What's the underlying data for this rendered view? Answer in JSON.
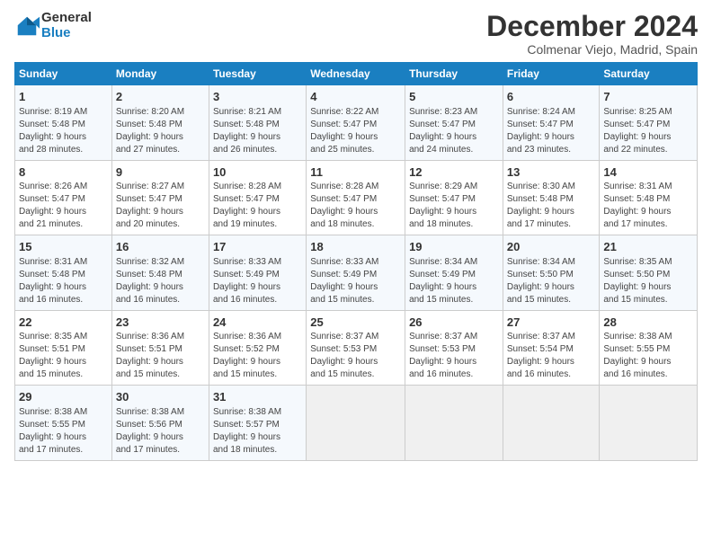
{
  "logo": {
    "text_general": "General",
    "text_blue": "Blue"
  },
  "header": {
    "month": "December 2024",
    "location": "Colmenar Viejo, Madrid, Spain"
  },
  "days_of_week": [
    "Sunday",
    "Monday",
    "Tuesday",
    "Wednesday",
    "Thursday",
    "Friday",
    "Saturday"
  ],
  "weeks": [
    [
      {
        "day": "1",
        "info": "Sunrise: 8:19 AM\nSunset: 5:48 PM\nDaylight: 9 hours\nand 28 minutes."
      },
      {
        "day": "2",
        "info": "Sunrise: 8:20 AM\nSunset: 5:48 PM\nDaylight: 9 hours\nand 27 minutes."
      },
      {
        "day": "3",
        "info": "Sunrise: 8:21 AM\nSunset: 5:48 PM\nDaylight: 9 hours\nand 26 minutes."
      },
      {
        "day": "4",
        "info": "Sunrise: 8:22 AM\nSunset: 5:47 PM\nDaylight: 9 hours\nand 25 minutes."
      },
      {
        "day": "5",
        "info": "Sunrise: 8:23 AM\nSunset: 5:47 PM\nDaylight: 9 hours\nand 24 minutes."
      },
      {
        "day": "6",
        "info": "Sunrise: 8:24 AM\nSunset: 5:47 PM\nDaylight: 9 hours\nand 23 minutes."
      },
      {
        "day": "7",
        "info": "Sunrise: 8:25 AM\nSunset: 5:47 PM\nDaylight: 9 hours\nand 22 minutes."
      }
    ],
    [
      {
        "day": "8",
        "info": "Sunrise: 8:26 AM\nSunset: 5:47 PM\nDaylight: 9 hours\nand 21 minutes."
      },
      {
        "day": "9",
        "info": "Sunrise: 8:27 AM\nSunset: 5:47 PM\nDaylight: 9 hours\nand 20 minutes."
      },
      {
        "day": "10",
        "info": "Sunrise: 8:28 AM\nSunset: 5:47 PM\nDaylight: 9 hours\nand 19 minutes."
      },
      {
        "day": "11",
        "info": "Sunrise: 8:28 AM\nSunset: 5:47 PM\nDaylight: 9 hours\nand 18 minutes."
      },
      {
        "day": "12",
        "info": "Sunrise: 8:29 AM\nSunset: 5:47 PM\nDaylight: 9 hours\nand 18 minutes."
      },
      {
        "day": "13",
        "info": "Sunrise: 8:30 AM\nSunset: 5:48 PM\nDaylight: 9 hours\nand 17 minutes."
      },
      {
        "day": "14",
        "info": "Sunrise: 8:31 AM\nSunset: 5:48 PM\nDaylight: 9 hours\nand 17 minutes."
      }
    ],
    [
      {
        "day": "15",
        "info": "Sunrise: 8:31 AM\nSunset: 5:48 PM\nDaylight: 9 hours\nand 16 minutes."
      },
      {
        "day": "16",
        "info": "Sunrise: 8:32 AM\nSunset: 5:48 PM\nDaylight: 9 hours\nand 16 minutes."
      },
      {
        "day": "17",
        "info": "Sunrise: 8:33 AM\nSunset: 5:49 PM\nDaylight: 9 hours\nand 16 minutes."
      },
      {
        "day": "18",
        "info": "Sunrise: 8:33 AM\nSunset: 5:49 PM\nDaylight: 9 hours\nand 15 minutes."
      },
      {
        "day": "19",
        "info": "Sunrise: 8:34 AM\nSunset: 5:49 PM\nDaylight: 9 hours\nand 15 minutes."
      },
      {
        "day": "20",
        "info": "Sunrise: 8:34 AM\nSunset: 5:50 PM\nDaylight: 9 hours\nand 15 minutes."
      },
      {
        "day": "21",
        "info": "Sunrise: 8:35 AM\nSunset: 5:50 PM\nDaylight: 9 hours\nand 15 minutes."
      }
    ],
    [
      {
        "day": "22",
        "info": "Sunrise: 8:35 AM\nSunset: 5:51 PM\nDaylight: 9 hours\nand 15 minutes."
      },
      {
        "day": "23",
        "info": "Sunrise: 8:36 AM\nSunset: 5:51 PM\nDaylight: 9 hours\nand 15 minutes."
      },
      {
        "day": "24",
        "info": "Sunrise: 8:36 AM\nSunset: 5:52 PM\nDaylight: 9 hours\nand 15 minutes."
      },
      {
        "day": "25",
        "info": "Sunrise: 8:37 AM\nSunset: 5:53 PM\nDaylight: 9 hours\nand 15 minutes."
      },
      {
        "day": "26",
        "info": "Sunrise: 8:37 AM\nSunset: 5:53 PM\nDaylight: 9 hours\nand 16 minutes."
      },
      {
        "day": "27",
        "info": "Sunrise: 8:37 AM\nSunset: 5:54 PM\nDaylight: 9 hours\nand 16 minutes."
      },
      {
        "day": "28",
        "info": "Sunrise: 8:38 AM\nSunset: 5:55 PM\nDaylight: 9 hours\nand 16 minutes."
      }
    ],
    [
      {
        "day": "29",
        "info": "Sunrise: 8:38 AM\nSunset: 5:55 PM\nDaylight: 9 hours\nand 17 minutes."
      },
      {
        "day": "30",
        "info": "Sunrise: 8:38 AM\nSunset: 5:56 PM\nDaylight: 9 hours\nand 17 minutes."
      },
      {
        "day": "31",
        "info": "Sunrise: 8:38 AM\nSunset: 5:57 PM\nDaylight: 9 hours\nand 18 minutes."
      },
      {
        "day": "",
        "info": ""
      },
      {
        "day": "",
        "info": ""
      },
      {
        "day": "",
        "info": ""
      },
      {
        "day": "",
        "info": ""
      }
    ]
  ]
}
